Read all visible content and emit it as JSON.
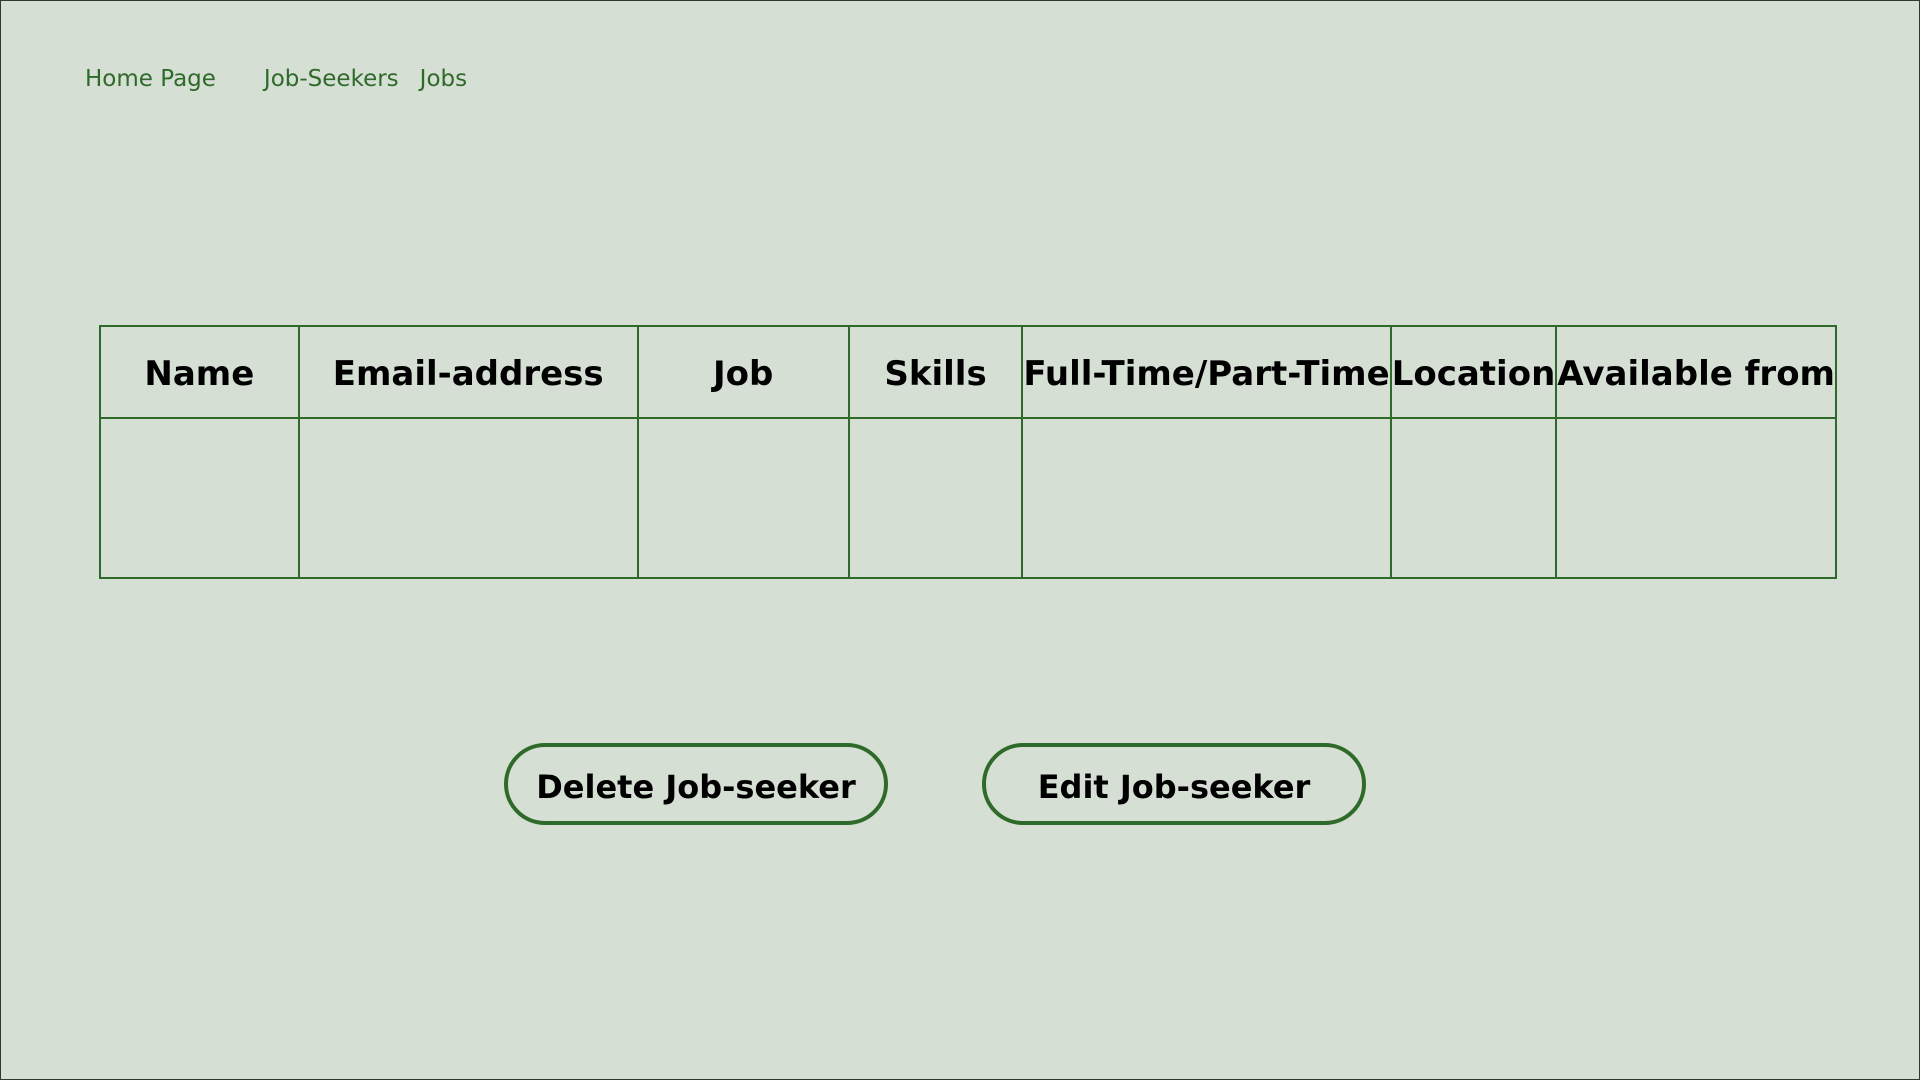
{
  "nav": {
    "items": [
      {
        "label": "Home Page"
      },
      {
        "label": "Job-Seekers"
      },
      {
        "label": "Jobs"
      }
    ]
  },
  "table": {
    "columns": [
      "Name",
      "Email-address",
      "Job",
      "Skills",
      "Full-Time/Part-Time",
      "Location",
      "Available from"
    ],
    "rows": [
      [
        "",
        "",
        "",
        "",
        "",
        "",
        ""
      ]
    ]
  },
  "actions": {
    "delete_label": "Delete Job-seeker",
    "edit_label": "Edit Job-seeker"
  },
  "colors": {
    "background": "#d5dfd4",
    "accent": "#2f6a2a",
    "text": "#000000"
  }
}
